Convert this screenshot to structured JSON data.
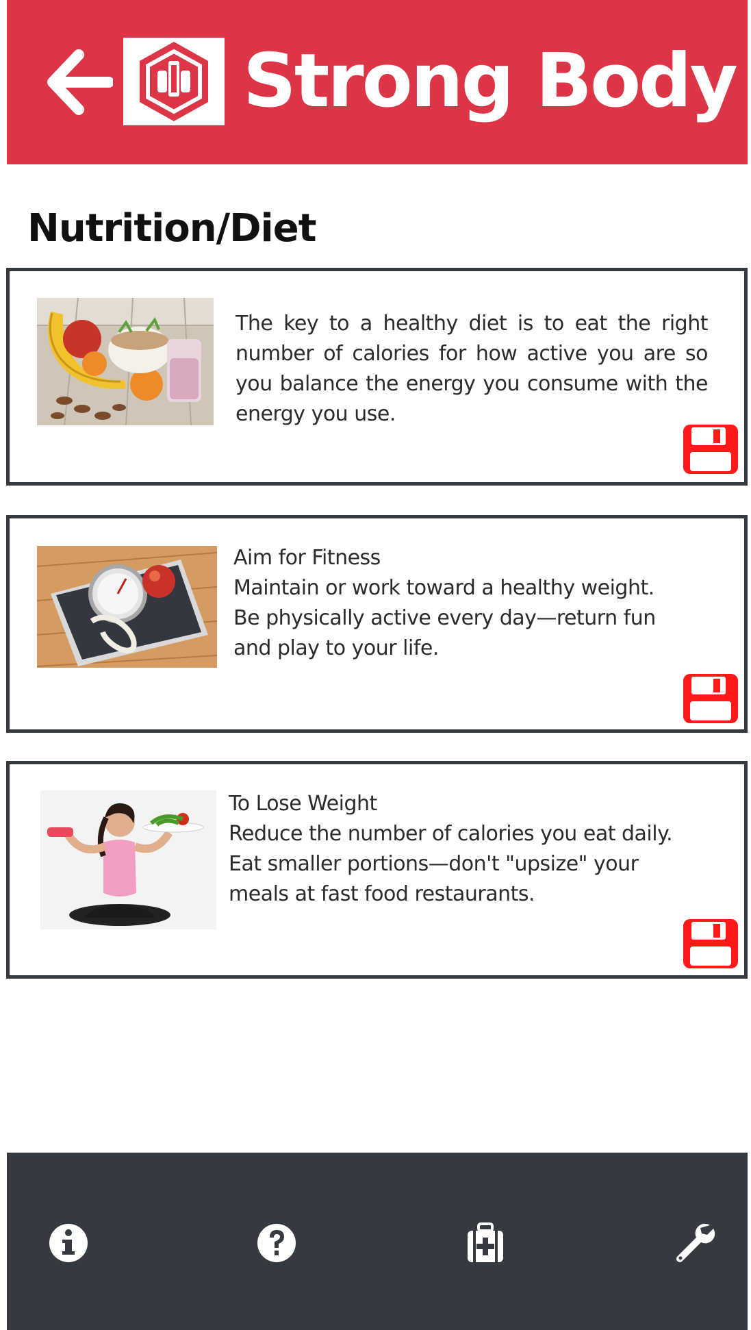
{
  "app": {
    "brand": "Strong Body"
  },
  "page": {
    "title": "Nutrition/Diet"
  },
  "cards": [
    {
      "lines": [
        "The key to a healthy diet is to eat the right number of calories for how active you are so you balance the energy you consume with the energy you use."
      ],
      "image": "healthy-food-photo"
    },
    {
      "lines": [
        "Aim for Fitness",
        "Maintain or work toward a healthy weight.",
        "Be physically active every day—return fun",
        "and play to your life."
      ],
      "image": "scale-and-apple-photo"
    },
    {
      "lines": [
        "To Lose Weight",
        "Reduce the number of calories you eat daily.",
        "Eat smaller portions—don't \"upsize\" your",
        "meals at fast food restaurants."
      ],
      "image": "woman-yoga-photo"
    }
  ],
  "nav": {
    "icons": [
      "info-icon",
      "question-icon",
      "medical-kit-icon",
      "wrench-icon"
    ]
  },
  "colors": {
    "header": "#dc3545",
    "nav": "#343a40",
    "save_icon": "#ff1a1a",
    "card_border": "#343a40"
  }
}
